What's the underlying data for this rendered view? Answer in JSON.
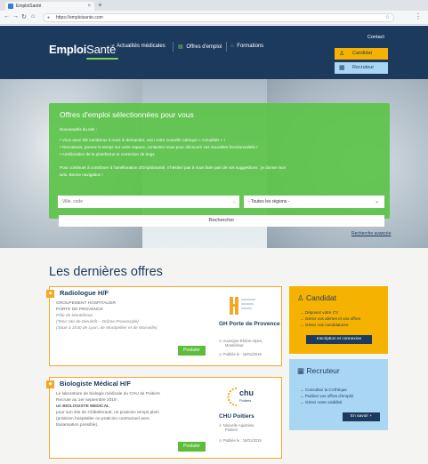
{
  "browser": {
    "tab_title": "EmploiSanté",
    "url": "https://emploisante.com",
    "new_tab_icon": "plus-icon",
    "tab_close": "×",
    "back": "←",
    "forward": "→",
    "reload": "↻",
    "home": "⌂",
    "lock": "🔒",
    "star": "☆",
    "menu": "⋮"
  },
  "header": {
    "logo_emploi": "Emploi",
    "logo_sante": "Santé",
    "nav": [
      {
        "icon": "⌂",
        "label": "Actualités médicales"
      },
      {
        "icon": "▤",
        "label": "Offres d'emploi"
      },
      {
        "icon": "🎓",
        "label": "Formations"
      }
    ],
    "contact": "Contact",
    "candidat_label": "Candidat",
    "candidat_icon": "👤",
    "recruteur_label": "Recruteur",
    "recruteur_icon": "▦"
  },
  "hero": {
    "title": "Offres d'emploi sélectionnées pour vous",
    "intro": "Nouveautés du site :",
    "bullets": [
      "• Vous avez été nombreux à nous le demander, voici votre nouvelle rubrique « Actualités » !",
      "• Recruteurs, prenez le temps sur votre espace, contactez-nous pour découvrir vos nouvelles fonctionnalités !",
      "• Amélioration de la plateforme et correction de bugs"
    ],
    "bullet2_link": "contactez-nous",
    "outro_1": "Pour continuer à contribuer à l'amélioration d'EmploiSanté, n'hésitez pas à nous faire part de vos suggestions : je donne mon",
    "outro_2": "avis. Bonne navigation !",
    "city_placeholder": "Ville, code",
    "region_value": "- Toutes les régions -",
    "search_button": "Rechercher",
    "advanced_search": "Recherche avancée"
  },
  "offers": {
    "section_title": "Les dernières offres",
    "items": [
      {
        "title": "Radiologue H/F",
        "lines": [
          "GROUPEMENT HOSPITALIER",
          "PORTE DE PROVENCE",
          "Pôle de Montélimar",
          "(Tenir site de Dieulefit – Drôme Provençale)",
          "(Situé à 1h30 de Lyon, de Montpellier et de Marseille)"
        ],
        "company": "GH Porte de Provence",
        "location": "Auvergne-Rhône-Alpes,",
        "city": "Montélimar",
        "posted": "Publiée le : 16/01/2019",
        "apply": "Postuler"
      },
      {
        "title": "Biologiste Médical H/F",
        "lines": [
          "Le laboratoire de biologie médicale du CHU de Poitiers",
          "Recrute au 1er septembre 2019 :",
          "un BIOLOGISTE MEDICAL",
          "pour son site de Châtellerault, un praticien temps plein",
          "(praticien hospitalier ou praticien contractuel avec",
          "titularisation possible)."
        ],
        "company": "CHU Poitiers",
        "location": "Nouvelle Aquitaine,",
        "city": "Poitiers",
        "posted": "Publiée le : 16/01/2019",
        "apply": "Postuler",
        "logo_text": "chu",
        "logo_sub": "Poitiers"
      }
    ]
  },
  "sidebar": {
    "candidat": {
      "title": "Candidat",
      "items": [
        "→ Déposez votre CV",
        "→ Gérez vos alertes et vos offres",
        "→ Gérez vos candidatures"
      ],
      "button": "Inscription et connexion"
    },
    "recruteur": {
      "title": "Recruteur",
      "items": [
        "→ Consultez la CVthèque",
        "→ Publiez vos offres d'emploi",
        "→ Gérez votre visibilité"
      ],
      "button": "En savoir +"
    }
  },
  "colors": {
    "navy": "#1b3a5e",
    "green": "#5cbd3a",
    "orange": "#f6a623",
    "yellow": "#f6b200",
    "light_blue": "#a9d6f2"
  }
}
